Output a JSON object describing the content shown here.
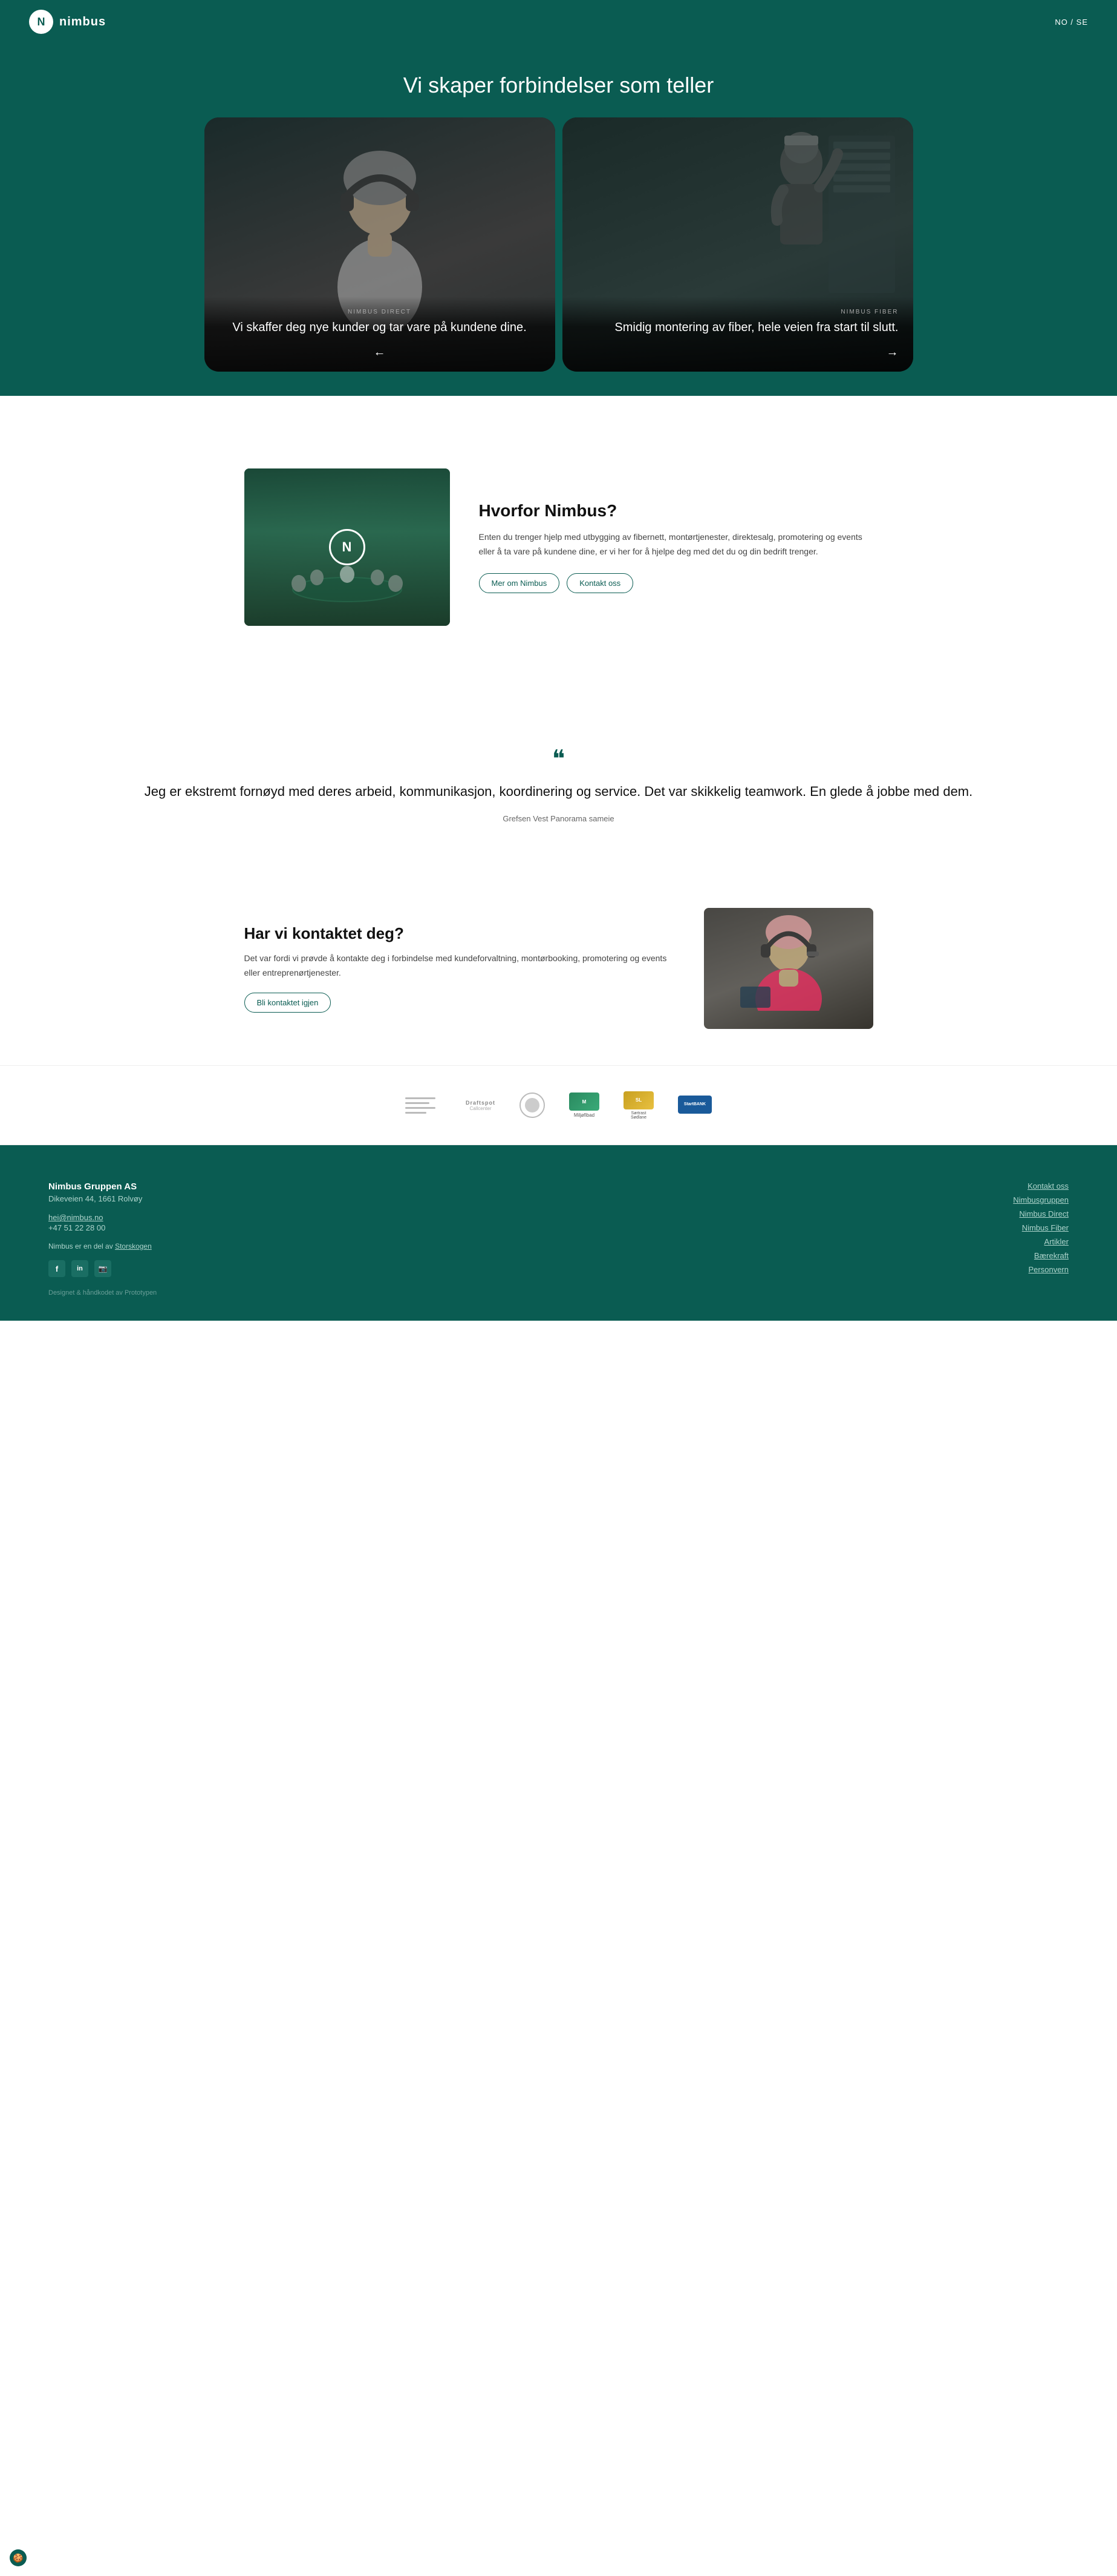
{
  "header": {
    "logo_initial": "N",
    "logo_name": "nimbus",
    "lang": "NO / SE"
  },
  "hero": {
    "title": "Vi skaper forbindelser som teller"
  },
  "slides": [
    {
      "label": "NIMBUS DIRECT",
      "description": "Vi skaffer deg nye kunder og tar vare på kundene dine.",
      "arrow": "←"
    },
    {
      "label": "NIMBUS FIBER",
      "description": "Smidig montering av fiber, hele veien fra start til slutt.",
      "arrow": "→"
    }
  ],
  "why": {
    "title": "Hvorfor Nimbus?",
    "description": "Enten du trenger hjelp med utbygging av fibernett, montørtjenester, direktesalg, promotering og events eller å ta vare på kundene dine, er vi her for å hjelpe deg med det du og din bedrift trenger.",
    "btn_more": "Mer om Nimbus",
    "btn_contact": "Kontakt oss"
  },
  "quote": {
    "mark": "❝",
    "text": "Jeg er ekstremt fornøyd med deres arbeid, kommunikasjon, koordinering og service. Det var skikkelig teamwork. En glede å jobbe med dem.",
    "author": "Grefsen Vest Panorama sameie"
  },
  "contact": {
    "title": "Har vi kontaktet deg?",
    "description": "Det var fordi vi prøvde å kontakte deg i forbindelse med kundeforvaltning, montørbooking, promotering og events eller entreprenørtjenester.",
    "btn": "Bli kontaktet igjen"
  },
  "partners": [
    {
      "name": "Partner 1",
      "type": "lines"
    },
    {
      "name": "Draftspot / Callcenter",
      "type": "text"
    },
    {
      "name": "Partner 3",
      "type": "circle"
    },
    {
      "name": "Miljøfibad",
      "type": "flag"
    },
    {
      "name": "Sørtrast Sødlane",
      "type": "badge"
    },
    {
      "name": "StartBANK",
      "type": "bank"
    }
  ],
  "footer": {
    "company": "Nimbus Gruppen AS",
    "address": "Dikeveien 44, 1661 Rolvøy",
    "email": "hei@nimbus.no",
    "phone": "+47 51 22 28 00",
    "storskogen_text": "Nimbus er en del av",
    "storskogen_link": "Storskogen",
    "social": [
      "f",
      "in",
      "📷"
    ],
    "designed": "Designet & håndkodet av Prototypen",
    "links": [
      "Kontakt oss",
      "Nimbusgruppen",
      "Nimbus Direct",
      "Nimbus Fiber",
      "Artikler",
      "Bærekraft",
      "Personvern"
    ]
  },
  "cookie_icon": "🍪"
}
